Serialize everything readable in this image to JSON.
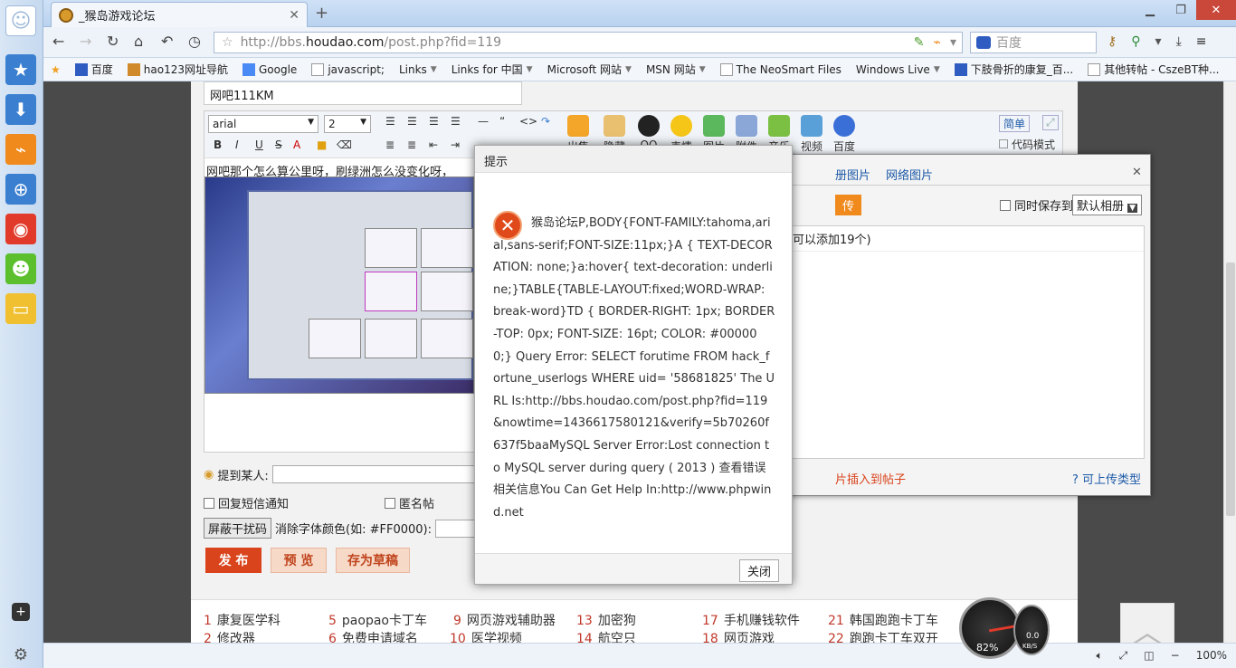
{
  "browser": {
    "tab_title": "_猴岛游戏论坛",
    "url_prefix": "http://bbs.",
    "url_host": "houdao.com",
    "url_path": "/post.php?fid=119",
    "search_placeholder": "百度",
    "zoom": "100%"
  },
  "bookmarks": [
    {
      "label": "百度",
      "icon": "baidu-icon"
    },
    {
      "label": "hao123网址导航",
      "icon": "hao123-icon"
    },
    {
      "label": "Google",
      "icon": "google-icon"
    },
    {
      "label": "javascript;",
      "icon": "page-icon"
    },
    {
      "label": "Links",
      "icon": "none"
    },
    {
      "label": "Links for 中国",
      "icon": "none"
    },
    {
      "label": "Microsoft 网站",
      "icon": "none"
    },
    {
      "label": "MSN 网站",
      "icon": "none"
    },
    {
      "label": "The NeoSmart Files",
      "icon": "page-icon"
    },
    {
      "label": "Windows Live",
      "icon": "none"
    },
    {
      "label": "下肢骨折的康复_百...",
      "icon": "baidu-icon"
    },
    {
      "label": "其他转帖 - CszeBT种...",
      "icon": "page-icon"
    }
  ],
  "post": {
    "title_value": "网吧111KM",
    "font_family": "arial",
    "font_size": "2",
    "body_text": "网吧那个怎么算公里呀，刷绿洲怎么没变化呀，",
    "toolbar_labels": [
      "出售",
      "隐藏",
      "QQ",
      "表情",
      "图片",
      "附件",
      "音乐",
      "视频",
      "百度"
    ],
    "simple_btn": "简单",
    "code_mode": "代码模式",
    "mention_label": "提到某人:",
    "reply_notify": "回复短信通知",
    "anonymous": "匿名帖",
    "shield_btn": "屏蔽干扰码",
    "clear_color_label": "消除字体颜色(如: #FF0000):",
    "publish": "发 布",
    "preview": "预 览",
    "draft": "存为草稿"
  },
  "photo_panel": {
    "tab_album": "册图片",
    "tab_web": "网络图片",
    "upload": "传",
    "save_to": "同时保存到",
    "default_album": "默认相册",
    "count_hint": "可以添加19个)",
    "insert_hint": "片插入到帖子",
    "upload_types": "可上传类型"
  },
  "dialog": {
    "title": "提示",
    "message": "猴岛论坛P,BODY{FONT-FAMILY:tahoma,arial,sans-serif;FONT-SIZE:11px;}A { TEXT-DECORATION: none;}a:hover{ text-decoration: underline;}TABLE{TABLE-LAYOUT:fixed;WORD-WRAP: break-word}TD { BORDER-RIGHT: 1px; BORDER-TOP: 0px; FONT-SIZE: 16pt; COLOR: #000000;} Query Error: SELECT forutime FROM hack_fortune_userlogs WHERE uid= '58681825' The URL Is:http://bbs.houdao.com/post.php?fid=119&nowtime=1436617580121&verify=5b70260f637f5baaMySQL Server Error:Lost connection to MySQL server during query ( 2013 ) 查看错误相关信息You Can Get Help In:http://www.phpwind.net",
    "close_btn": "关闭"
  },
  "links": [
    {
      "n": "1",
      "t": "康复医学科"
    },
    {
      "n": "5",
      "t": "paopao卡丁车"
    },
    {
      "n": "9",
      "t": "网页游戏辅助器"
    },
    {
      "n": "13",
      "t": "加密狗"
    },
    {
      "n": "17",
      "t": "手机赚钱软件"
    },
    {
      "n": "21",
      "t": "韩国跑跑卡丁车"
    },
    {
      "n": "2",
      "t": "修改器"
    },
    {
      "n": "6",
      "t": "免费申请域名"
    },
    {
      "n": "10",
      "t": "医学视频"
    },
    {
      "n": "14",
      "t": "航空只"
    },
    {
      "n": "18",
      "t": "网页游戏"
    },
    {
      "n": "22",
      "t": "跑跑卡丁车双开"
    }
  ],
  "gauge": {
    "percent": "82%",
    "speed": "0.0",
    "unit": "KB/S"
  },
  "colors": {
    "accent": "#d9441c",
    "link": "#1e5aa8",
    "dialog_icon": "#e04a1b"
  }
}
